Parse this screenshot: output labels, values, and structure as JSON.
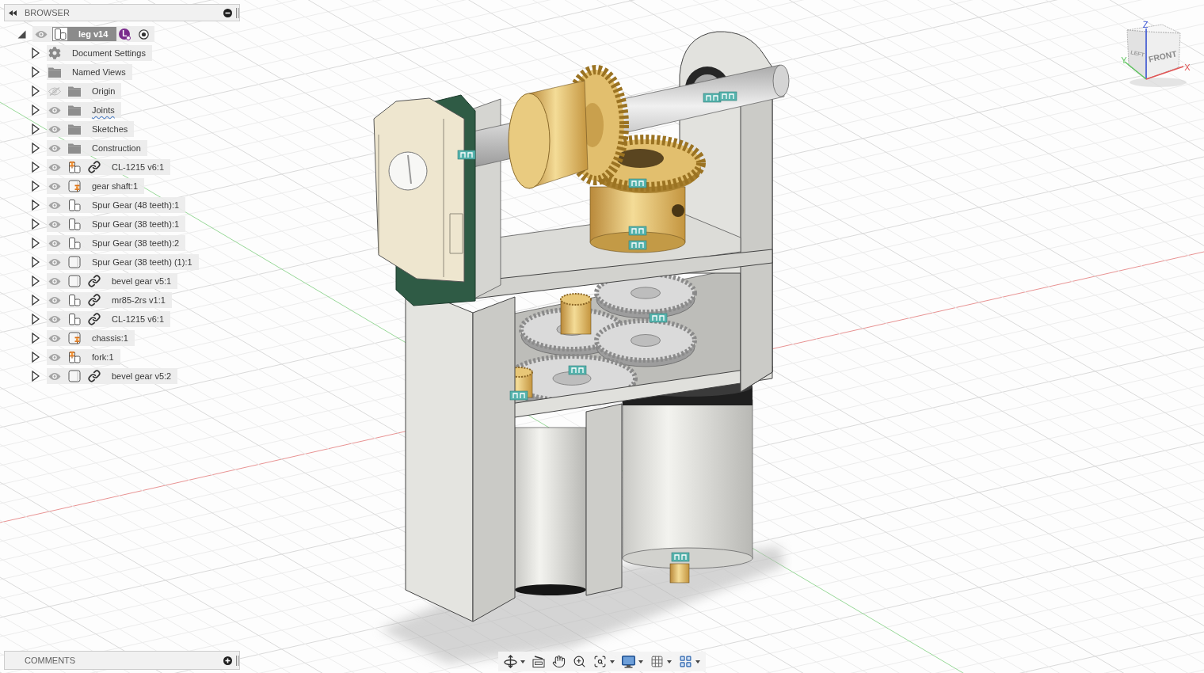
{
  "browser": {
    "title": "BROWSER",
    "root": {
      "name": "leg v14",
      "expanded": true,
      "visible": true,
      "badge": "L",
      "active": true,
      "children": [
        {
          "name": "Document Settings",
          "kind": "settings",
          "expanded": false,
          "linked": false,
          "grounded": false,
          "warning": false
        },
        {
          "name": "Named Views",
          "kind": "folder",
          "expanded": false,
          "linked": false,
          "grounded": false,
          "warning": false
        },
        {
          "name": "Origin",
          "kind": "folder",
          "visible": false,
          "expanded": false,
          "linked": false,
          "grounded": false,
          "warning": false
        },
        {
          "name": "Joints",
          "kind": "folder",
          "visible": true,
          "expanded": false,
          "linked": false,
          "grounded": false,
          "warning": true
        },
        {
          "name": "Sketches",
          "kind": "folder",
          "visible": true,
          "expanded": false,
          "linked": false,
          "grounded": false,
          "warning": false
        },
        {
          "name": "Construction",
          "kind": "folder",
          "visible": true,
          "expanded": false,
          "linked": false,
          "grounded": false,
          "warning": false
        },
        {
          "name": "CL-1215 v6:1",
          "kind": "component",
          "visible": true,
          "expanded": false,
          "linked": true,
          "grounded": true,
          "warning": false
        },
        {
          "name": "gear shaft:1",
          "kind": "body",
          "visible": true,
          "expanded": false,
          "linked": false,
          "grounded": true,
          "warning": false
        },
        {
          "name": "Spur Gear (48 teeth):1",
          "kind": "component",
          "visible": true,
          "expanded": false,
          "linked": false,
          "grounded": false,
          "warning": false
        },
        {
          "name": "Spur Gear (38 teeth):1",
          "kind": "component",
          "visible": true,
          "expanded": false,
          "linked": false,
          "grounded": false,
          "warning": false
        },
        {
          "name": "Spur Gear (38 teeth):2",
          "kind": "component",
          "visible": true,
          "expanded": false,
          "linked": false,
          "grounded": false,
          "warning": false
        },
        {
          "name": "Spur Gear (38 teeth) (1):1",
          "kind": "body",
          "visible": true,
          "expanded": false,
          "linked": false,
          "grounded": false,
          "warning": false
        },
        {
          "name": "bevel gear v5:1",
          "kind": "body",
          "visible": true,
          "expanded": false,
          "linked": true,
          "grounded": false,
          "warning": false
        },
        {
          "name": "mr85-2rs v1:1",
          "kind": "component",
          "visible": true,
          "expanded": false,
          "linked": true,
          "grounded": false,
          "warning": false
        },
        {
          "name": "CL-1215 v6:1",
          "kind": "component",
          "visible": true,
          "expanded": false,
          "linked": true,
          "grounded": false,
          "warning": false
        },
        {
          "name": "chassis:1",
          "kind": "body",
          "visible": true,
          "expanded": false,
          "linked": false,
          "grounded": true,
          "warning": false
        },
        {
          "name": "fork:1",
          "kind": "component",
          "visible": true,
          "expanded": false,
          "linked": false,
          "grounded": true,
          "warning": false
        },
        {
          "name": "bevel gear v5:2",
          "kind": "body",
          "visible": true,
          "expanded": false,
          "linked": true,
          "grounded": false,
          "warning": false
        }
      ]
    }
  },
  "viewcube": {
    "front": "FRONT",
    "left": "LEFT",
    "z_axis": "Z",
    "y_axis": "Y",
    "x_axis": "X"
  },
  "comments": {
    "title": "COMMENTS"
  },
  "navigation_toolbar": {
    "tools": [
      {
        "kind": "orbit",
        "dropdown": true
      },
      {
        "kind": "look_at",
        "dropdown": false
      },
      {
        "kind": "pan",
        "dropdown": false
      },
      {
        "kind": "zoom",
        "dropdown": false
      },
      {
        "kind": "fit",
        "dropdown": true
      },
      {
        "kind": "display",
        "dropdown": true
      },
      {
        "kind": "grid",
        "dropdown": true
      },
      {
        "kind": "viewports",
        "dropdown": true
      }
    ]
  }
}
